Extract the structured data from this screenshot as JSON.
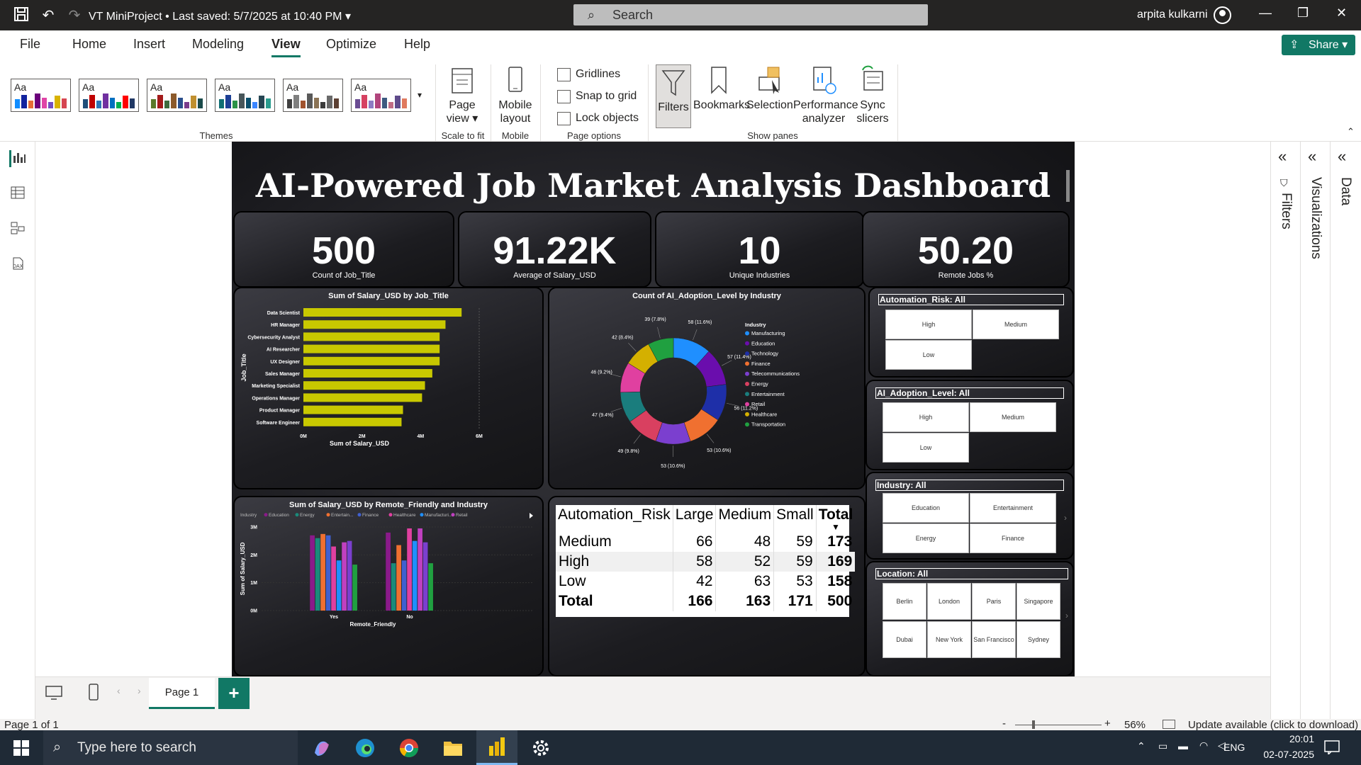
{
  "titlebar": {
    "doc_title": "VT MiniProject • Last saved: 5/7/2025 at 10:40 PM",
    "search_placeholder": "Search",
    "user": "arpita kulkarni"
  },
  "menu": [
    "File",
    "Home",
    "Insert",
    "Modeling",
    "View",
    "Optimize",
    "Help"
  ],
  "share_label": "Share",
  "ribbon": {
    "themes_label": "Themes",
    "theme_sample": "Aa",
    "page_view": "Page view",
    "scale_label": "Scale to fit",
    "mobile_layout": "Mobile layout",
    "mobile_label": "Mobile",
    "gridlines": "Gridlines",
    "snap": "Snap to grid",
    "lock": "Lock objects",
    "page_options_label": "Page options",
    "filters": "Filters",
    "bookmarks": "Bookmarks",
    "selection": "Selection",
    "performance": "Performance analyzer",
    "sync": "Sync slicers",
    "show_panes_label": "Show panes"
  },
  "panes": {
    "filters": "Filters",
    "visualizations": "Visualizations",
    "data": "Data"
  },
  "report": {
    "title": "AI-Powered Job Market Analysis Dashboard",
    "kpis": [
      {
        "value": "500",
        "label": "Count of Job_Title"
      },
      {
        "value": "91.22K",
        "label": "Average of Salary_USD"
      },
      {
        "value": "10",
        "label": "Unique Industries"
      },
      {
        "value": "50.20",
        "label": "Remote Jobs %"
      }
    ],
    "slicers": {
      "automation": {
        "title": "Automation_Risk: All",
        "options": [
          "High",
          "Medium",
          "Low"
        ]
      },
      "adoption": {
        "title": "AI_Adoption_Level: All",
        "options": [
          "High",
          "Medium",
          "Low"
        ]
      },
      "industry": {
        "title": "Industry: All",
        "options": [
          "Education",
          "Entertainment",
          "Energy",
          "Finance"
        ]
      },
      "location": {
        "title": "Location: All",
        "options": [
          "Berlin",
          "London",
          "Paris",
          "Singapore",
          "Dubai",
          "New York",
          "San Francisco",
          "Sydney"
        ]
      }
    },
    "matrix": {
      "headers": [
        "Automation_Risk",
        "Large",
        "Medium",
        "Small",
        "Total"
      ],
      "rows": [
        [
          "Medium",
          "66",
          "48",
          "59",
          "173"
        ],
        [
          "High",
          "58",
          "52",
          "59",
          "169"
        ],
        [
          "Low",
          "42",
          "63",
          "53",
          "158"
        ]
      ],
      "total": [
        "Total",
        "166",
        "163",
        "171",
        "500"
      ]
    }
  },
  "chart_data": [
    {
      "type": "bar",
      "orientation": "horizontal",
      "title": "Sum of Salary_USD by Job_Title",
      "xlabel": "Sum of Salary_USD",
      "ylabel": "Job_Title",
      "categories": [
        "Data Scientist",
        "HR Manager",
        "Cybersecurity Analyst",
        "AI Researcher",
        "UX Designer",
        "Sales Manager",
        "Marketing Specialist",
        "Operations Manager",
        "Product Manager",
        "Software Engineer"
      ],
      "values": [
        5400000,
        4850000,
        4650000,
        4650000,
        4650000,
        4400000,
        4150000,
        4050000,
        3400000,
        3350000
      ],
      "xticks": [
        "0M",
        "2M",
        "4M",
        "6M"
      ],
      "xlim": [
        0,
        6000000
      ],
      "color": "#c8c800"
    },
    {
      "type": "pie",
      "donut": true,
      "title": "Count of AI_Adoption_Level by Industry",
      "legend_title": "Industry",
      "labels": [
        "Manufacturing",
        "Education",
        "Technology",
        "Finance",
        "Telecommunications",
        "Energy",
        "Entertainment",
        "Retail",
        "Healthcare",
        "Transportation"
      ],
      "values": [
        58,
        57,
        56,
        53,
        53,
        49,
        47,
        46,
        42,
        39
      ],
      "data_labels": [
        "58 (11.6%)",
        "57 (11.4%)",
        "56 (11.2%)",
        "53 (10.6%)",
        "53 (10.6%)",
        "49 (9.8%)",
        "47 (9.4%)",
        "46 (9.2%)",
        "42 (8.4%)",
        "39 (7.8%)"
      ],
      "colors": [
        "#1f8fff",
        "#6a0dad",
        "#1e2fa8",
        "#f07030",
        "#7b3fcf",
        "#d94060",
        "#1a7d7d",
        "#e040a0",
        "#d4b000",
        "#20a040"
      ]
    },
    {
      "type": "bar",
      "title": "Sum of Salary_USD by Remote_Friendly and Industry",
      "legend_title": "Industry",
      "legend_entries": [
        "Education",
        "Energy",
        "Entertain...",
        "Finance",
        "Healthcare",
        "Manufacturi...",
        "Retail"
      ],
      "xlabel": "Remote_Friendly",
      "ylabel": "Sum of Salary_USD",
      "categories": [
        "Yes",
        "No"
      ],
      "yticks": [
        "0M",
        "1M",
        "2M",
        "3M"
      ],
      "ylim": [
        0,
        3000000
      ],
      "series": [
        {
          "name": "Education",
          "values": [
            2700000,
            2800000
          ]
        },
        {
          "name": "Energy",
          "values": [
            2600000,
            1700000
          ]
        },
        {
          "name": "Entertainment",
          "values": [
            2750000,
            2350000
          ]
        },
        {
          "name": "Finance",
          "values": [
            2700000,
            1800000
          ]
        },
        {
          "name": "Healthcare",
          "values": [
            2300000,
            2950000
          ]
        },
        {
          "name": "Manufacturing",
          "values": [
            1800000,
            2500000
          ]
        },
        {
          "name": "Retail",
          "values": [
            2450000,
            2950000
          ]
        },
        {
          "name": "Technology",
          "values": [
            2500000,
            2450000
          ]
        },
        {
          "name": "Telecommunications",
          "values": [
            1650000,
            1700000
          ]
        }
      ],
      "colors": [
        "#8a1a8a",
        "#1a8a7a",
        "#f07030",
        "#4060d0",
        "#e040a0",
        "#1f8fff",
        "#c040c0",
        "#7b3fcf",
        "#20a040"
      ]
    }
  ],
  "tabs": {
    "page": "Page 1"
  },
  "status": {
    "page": "Page 1 of 1",
    "zoom": "56%",
    "update": "Update available (click to download)"
  },
  "taskbar": {
    "search": "Type here to search",
    "lang": "ENG",
    "time": "20:01",
    "date": "02-07-2025"
  }
}
